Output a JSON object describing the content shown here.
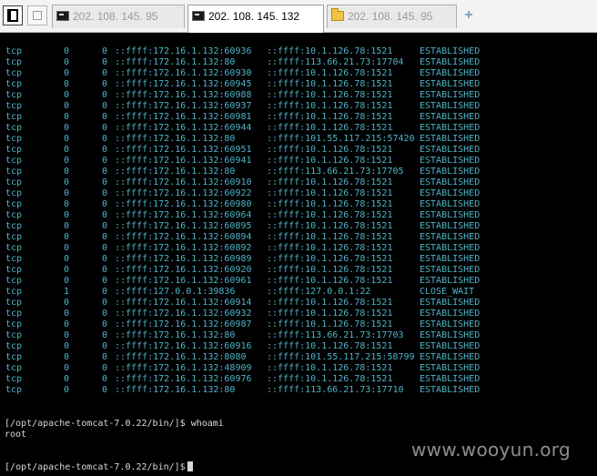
{
  "tabs": [
    {
      "label": "202. 108. 145. 95",
      "icon": "terminal-icon",
      "active": false
    },
    {
      "label": "202. 108. 145. 132",
      "icon": "terminal-icon",
      "active": true
    },
    {
      "label": "202. 108. 145. 95",
      "icon": "folder-icon",
      "active": false
    }
  ],
  "add_tab_label": "+",
  "terminal": {
    "connections": [
      {
        "proto": "tcp",
        "recv_q": "0",
        "send_q": "0",
        "local": "::ffff:172.16.1.132:60936",
        "foreign": "::ffff:10.1.126.78:1521",
        "state": "ESTABLISHED"
      },
      {
        "proto": "tcp",
        "recv_q": "0",
        "send_q": "0",
        "local": "::ffff:172.16.1.132:80",
        "foreign": "::ffff:113.66.21.73:17704",
        "state": "ESTABLISHED"
      },
      {
        "proto": "tcp",
        "recv_q": "0",
        "send_q": "0",
        "local": "::ffff:172.16.1.132:60930",
        "foreign": "::ffff:10.1.126.78:1521",
        "state": "ESTABLISHED"
      },
      {
        "proto": "tcp",
        "recv_q": "0",
        "send_q": "0",
        "local": "::ffff:172.16.1.132:60945",
        "foreign": "::ffff:10.1.126.78:1521",
        "state": "ESTABLISHED"
      },
      {
        "proto": "tcp",
        "recv_q": "0",
        "send_q": "0",
        "local": "::ffff:172.16.1.132:60988",
        "foreign": "::ffff:10.1.126.78:1521",
        "state": "ESTABLISHED"
      },
      {
        "proto": "tcp",
        "recv_q": "0",
        "send_q": "0",
        "local": "::ffff:172.16.1.132:60937",
        "foreign": "::ffff:10.1.126.78:1521",
        "state": "ESTABLISHED"
      },
      {
        "proto": "tcp",
        "recv_q": "0",
        "send_q": "0",
        "local": "::ffff:172.16.1.132:60981",
        "foreign": "::ffff:10.1.126.78:1521",
        "state": "ESTABLISHED"
      },
      {
        "proto": "tcp",
        "recv_q": "0",
        "send_q": "0",
        "local": "::ffff:172.16.1.132:60944",
        "foreign": "::ffff:10.1.126.78:1521",
        "state": "ESTABLISHED"
      },
      {
        "proto": "tcp",
        "recv_q": "0",
        "send_q": "0",
        "local": "::ffff:172.16.1.132:80",
        "foreign": "::ffff:101.55.117.215:57420",
        "state": "ESTABLISHED"
      },
      {
        "proto": "tcp",
        "recv_q": "0",
        "send_q": "0",
        "local": "::ffff:172.16.1.132:60951",
        "foreign": "::ffff:10.1.126.78:1521",
        "state": "ESTABLISHED"
      },
      {
        "proto": "tcp",
        "recv_q": "0",
        "send_q": "0",
        "local": "::ffff:172.16.1.132:60941",
        "foreign": "::ffff:10.1.126.78:1521",
        "state": "ESTABLISHED"
      },
      {
        "proto": "tcp",
        "recv_q": "0",
        "send_q": "0",
        "local": "::ffff:172.16.1.132:80",
        "foreign": "::ffff:113.66.21.73:17705",
        "state": "ESTABLISHED"
      },
      {
        "proto": "tcp",
        "recv_q": "0",
        "send_q": "0",
        "local": "::ffff:172.16.1.132:60910",
        "foreign": "::ffff:10.1.126.78:1521",
        "state": "ESTABLISHED"
      },
      {
        "proto": "tcp",
        "recv_q": "0",
        "send_q": "0",
        "local": "::ffff:172.16.1.132:60922",
        "foreign": "::ffff:10.1.126.78:1521",
        "state": "ESTABLISHED"
      },
      {
        "proto": "tcp",
        "recv_q": "0",
        "send_q": "0",
        "local": "::ffff:172.16.1.132:60980",
        "foreign": "::ffff:10.1.126.78:1521",
        "state": "ESTABLISHED"
      },
      {
        "proto": "tcp",
        "recv_q": "0",
        "send_q": "0",
        "local": "::ffff:172.16.1.132:60964",
        "foreign": "::ffff:10.1.126.78:1521",
        "state": "ESTABLISHED"
      },
      {
        "proto": "tcp",
        "recv_q": "0",
        "send_q": "0",
        "local": "::ffff:172.16.1.132:60895",
        "foreign": "::ffff:10.1.126.78:1521",
        "state": "ESTABLISHED"
      },
      {
        "proto": "tcp",
        "recv_q": "0",
        "send_q": "0",
        "local": "::ffff:172.16.1.132:60894",
        "foreign": "::ffff:10.1.126.78:1521",
        "state": "ESTABLISHED"
      },
      {
        "proto": "tcp",
        "recv_q": "0",
        "send_q": "0",
        "local": "::ffff:172.16.1.132:60892",
        "foreign": "::ffff:10.1.126.78:1521",
        "state": "ESTABLISHED"
      },
      {
        "proto": "tcp",
        "recv_q": "0",
        "send_q": "0",
        "local": "::ffff:172.16.1.132:60989",
        "foreign": "::ffff:10.1.126.78:1521",
        "state": "ESTABLISHED"
      },
      {
        "proto": "tcp",
        "recv_q": "0",
        "send_q": "0",
        "local": "::ffff:172.16.1.132:60920",
        "foreign": "::ffff:10.1.126.78:1521",
        "state": "ESTABLISHED"
      },
      {
        "proto": "tcp",
        "recv_q": "0",
        "send_q": "0",
        "local": "::ffff:172.16.1.132:60961",
        "foreign": "::ffff:10.1.126.78:1521",
        "state": "ESTABLISHED"
      },
      {
        "proto": "tcp",
        "recv_q": "1",
        "send_q": "0",
        "local": "::ffff:127.0.0.1:39836",
        "foreign": "::ffff:127.0.0.1:22",
        "state": "CLOSE_WAIT"
      },
      {
        "proto": "tcp",
        "recv_q": "0",
        "send_q": "0",
        "local": "::ffff:172.16.1.132:60914",
        "foreign": "::ffff:10.1.126.78:1521",
        "state": "ESTABLISHED"
      },
      {
        "proto": "tcp",
        "recv_q": "0",
        "send_q": "0",
        "local": "::ffff:172.16.1.132:60932",
        "foreign": "::ffff:10.1.126.78:1521",
        "state": "ESTABLISHED"
      },
      {
        "proto": "tcp",
        "recv_q": "0",
        "send_q": "0",
        "local": "::ffff:172.16.1.132:60987",
        "foreign": "::ffff:10.1.126.78:1521",
        "state": "ESTABLISHED"
      },
      {
        "proto": "tcp",
        "recv_q": "0",
        "send_q": "0",
        "local": "::ffff:172.16.1.132:80",
        "foreign": "::ffff:113.66.21.73:17703",
        "state": "ESTABLISHED"
      },
      {
        "proto": "tcp",
        "recv_q": "0",
        "send_q": "0",
        "local": "::ffff:172.16.1.132:60916",
        "foreign": "::ffff:10.1.126.78:1521",
        "state": "ESTABLISHED"
      },
      {
        "proto": "tcp",
        "recv_q": "0",
        "send_q": "0",
        "local": "::ffff:172.16.1.132:8080",
        "foreign": "::ffff:101.55.117.215:58799",
        "state": "ESTABLISHED"
      },
      {
        "proto": "tcp",
        "recv_q": "0",
        "send_q": "0",
        "local": "::ffff:172.16.1.132:48909",
        "foreign": "::ffff:10.1.126.78:1521",
        "state": "ESTABLISHED"
      },
      {
        "proto": "tcp",
        "recv_q": "0",
        "send_q": "0",
        "local": "::ffff:172.16.1.132:60976",
        "foreign": "::ffff:10.1.126.78:1521",
        "state": "ESTABLISHED"
      },
      {
        "proto": "tcp",
        "recv_q": "0",
        "send_q": "0",
        "local": "::ffff:172.16.1.132:80",
        "foreign": "::ffff:113.66.21.73:17710",
        "state": "ESTABLISHED"
      }
    ],
    "prompt_1": "[/opt/apache-tomcat-7.0.22/bin/]$ whoami",
    "output_1": "root",
    "prompt_2": "[/opt/apache-tomcat-7.0.22/bin/]$"
  },
  "watermark": "www.wooyun.org",
  "colors": {
    "terminal_bg": "#000000",
    "netstat_text": "#4fb3c7",
    "prompt_text": "#d8d8d8",
    "tabbar_bg": "#f3f3f3"
  }
}
